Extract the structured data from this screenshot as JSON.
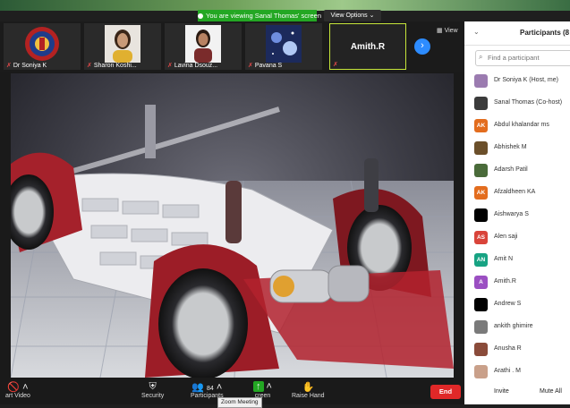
{
  "banner": {
    "text": "You are viewing Sanal Thomas' screen",
    "view_options": "View Options ⌄"
  },
  "thumbnails": [
    {
      "name": "Dr Soniya K",
      "pic": "logo"
    },
    {
      "name": "Sharon Koshi...",
      "pic": "person"
    },
    {
      "name": "Lavina Dsouz...",
      "pic": "person"
    },
    {
      "name": "Pavana S",
      "pic": "space"
    },
    {
      "name": "Amith.R",
      "pic": "none"
    }
  ],
  "strip": {
    "view_label": "View",
    "next_icon": "chevron-right-icon"
  },
  "toolbar": {
    "start_video": "art Video",
    "security": "Security",
    "participants_label": "Participants",
    "participants_count": "84",
    "share_screen": "creen",
    "raise_hand": "Raise Hand",
    "end": "End",
    "tooltip": "Zoom Meeting"
  },
  "panel": {
    "title": "Participants (8",
    "search_placeholder": "Find a participant",
    "participants": [
      {
        "name": "Dr Soniya K (Host, me)",
        "initials": "",
        "color": "#9b7bb0"
      },
      {
        "name": "Sanal Thomas (Co-host)",
        "initials": "",
        "color": "#3b3b3b"
      },
      {
        "name": "Abdul khalandar ms",
        "initials": "AK",
        "color": "#e36d1e"
      },
      {
        "name": "Abhishek M",
        "initials": "",
        "color": "#6b4f2a"
      },
      {
        "name": "Adarsh Patil",
        "initials": "",
        "color": "#4a6b3a"
      },
      {
        "name": "Afzaldheen KA",
        "initials": "AK",
        "color": "#e36d1e"
      },
      {
        "name": "Aishwarya S",
        "initials": "",
        "color": "#000000"
      },
      {
        "name": "Alen saji",
        "initials": "AS",
        "color": "#d9443a"
      },
      {
        "name": "Amit N",
        "initials": "AN",
        "color": "#17a383"
      },
      {
        "name": "Amith.R",
        "initials": "A",
        "color": "#9b4fc2"
      },
      {
        "name": "Andrew S",
        "initials": "",
        "color": "#000000"
      },
      {
        "name": "ankith ghimire",
        "initials": "",
        "color": "#7a7a7a"
      },
      {
        "name": "Anusha R",
        "initials": "",
        "color": "#8a4b3a"
      },
      {
        "name": "Arathi . M",
        "initials": "",
        "color": "#c9a08a"
      }
    ],
    "invite": "Invite",
    "mute_all": "Mute All"
  },
  "colors": {
    "accent": "#2d8cff",
    "end": "#e02828",
    "banner": "#23a723"
  }
}
